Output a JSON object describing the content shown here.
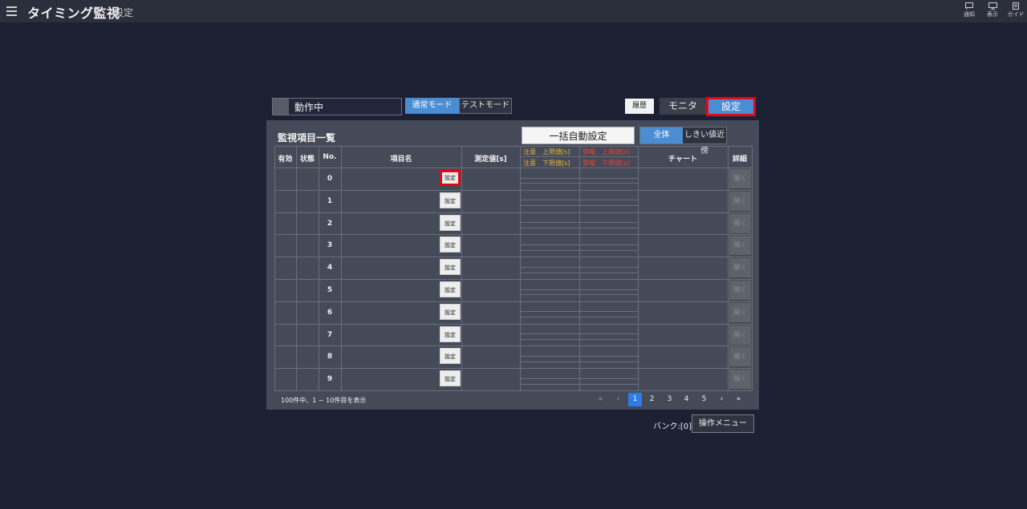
{
  "header": {
    "title": "タイミング監視",
    "subtitle": "設定",
    "tools": [
      {
        "label": "通知",
        "icon": "notification-icon"
      },
      {
        "label": "表示",
        "icon": "display-icon"
      },
      {
        "label": "ガイド",
        "icon": "guide-icon"
      }
    ]
  },
  "status": {
    "text": "動作中"
  },
  "mode": {
    "normal": "通常モード",
    "test": "テストモード"
  },
  "nav": {
    "history": "履歴",
    "monitor": "モニタ",
    "settings": "設定"
  },
  "panel": {
    "title": "監視項目一覧",
    "auto_button": "一括自動設定",
    "filter_all": "全体",
    "filter_near": "しきい値近傍"
  },
  "table": {
    "headers": {
      "enabled": "有効",
      "state": "状態",
      "no": "No.",
      "name": "項目名",
      "measured": "測定値[s]",
      "caution_upper": "注意　上限値[s]",
      "caution_lower": "注意　下限値[s]",
      "alarm_upper": "警報　上限値[s]",
      "alarm_lower": "警報　下限値[s]",
      "chart": "チャート",
      "detail": "詳細"
    },
    "colors": {
      "caution": "#e8b83a",
      "alarm": "#e8403a"
    },
    "set_label": "設定",
    "open_label": "開く",
    "rows": [
      {
        "no": "0"
      },
      {
        "no": "1"
      },
      {
        "no": "2"
      },
      {
        "no": "3"
      },
      {
        "no": "4"
      },
      {
        "no": "5"
      },
      {
        "no": "6"
      },
      {
        "no": "7"
      },
      {
        "no": "8"
      },
      {
        "no": "9"
      }
    ]
  },
  "pagination": {
    "summary": "100件中、1 ~ 10件目を表示",
    "first": "«",
    "prev": "‹",
    "pages": [
      "1",
      "2",
      "3",
      "4",
      "5"
    ],
    "next": "›",
    "last": "»",
    "current": "1"
  },
  "footer": {
    "bank": "バンク:[0]",
    "ops_menu": "操作メニュー"
  }
}
